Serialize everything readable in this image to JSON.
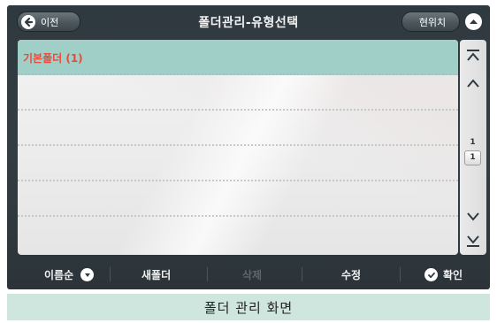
{
  "header": {
    "back_label": "이전",
    "title": "폴더관리-유형선택",
    "location_label": "현위치"
  },
  "list": {
    "items": [
      {
        "label": "기본폴더 (1)",
        "selected": true
      },
      {
        "label": ""
      },
      {
        "label": ""
      },
      {
        "label": ""
      },
      {
        "label": ""
      },
      {
        "label": ""
      }
    ]
  },
  "scroll": {
    "current_page": "1",
    "total_pages": "1"
  },
  "toolbar": {
    "sort_label": "이름순",
    "new_folder_label": "새폴더",
    "delete_label": "삭제",
    "edit_label": "수정",
    "confirm_label": "확인"
  },
  "caption": "폴더 관리 화면",
  "colors": {
    "accent_selected_row": "#9fcfc7",
    "item_text": "#e74b3c",
    "frame": "#323d43",
    "caption_bg": "#cfe6df"
  }
}
